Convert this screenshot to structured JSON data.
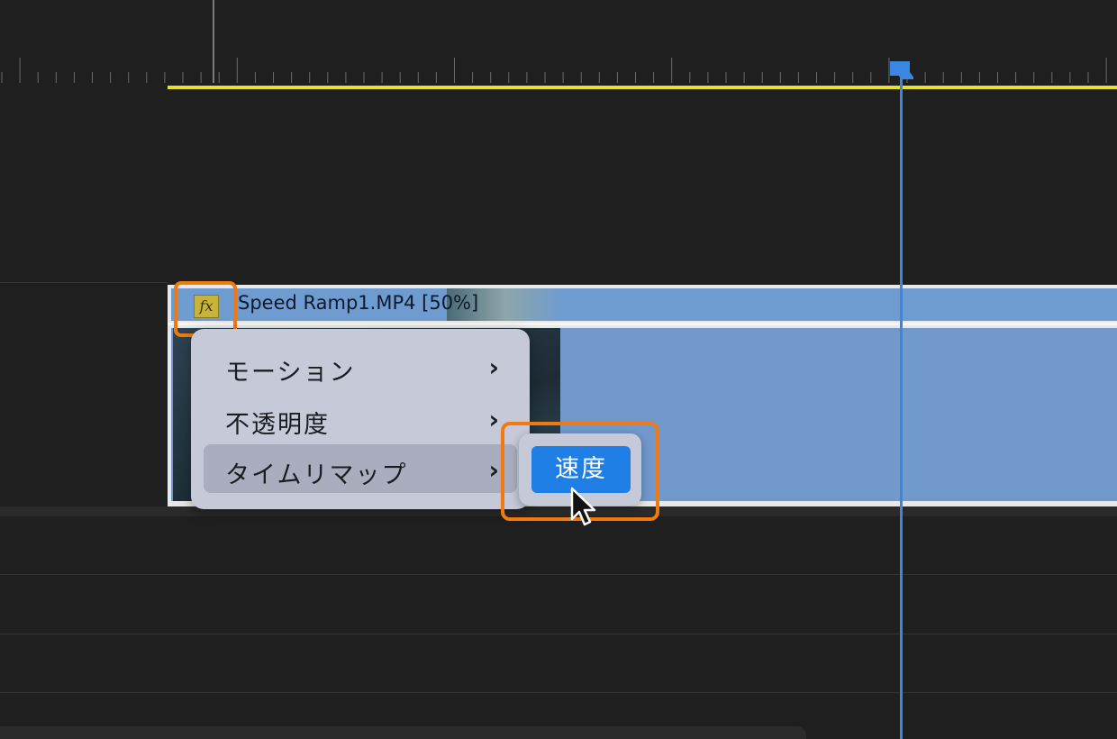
{
  "clip": {
    "title": "Speed Ramp1.MP4 [50%]",
    "fx_label": "fx"
  },
  "context_menu": {
    "items": [
      {
        "label": "モーション",
        "chevron": "›",
        "active": false
      },
      {
        "label": "不透明度",
        "chevron": "›",
        "active": false
      },
      {
        "label": "タイムリマップ",
        "chevron": "›",
        "active": true
      }
    ]
  },
  "submenu": {
    "speed_label": "速度"
  },
  "colors": {
    "highlight": "#f07a10",
    "playhead": "#3a86e0",
    "work_area": "#e6e02a",
    "clip": "#7299cc",
    "accent_button": "#1f7fe6"
  },
  "icons": {
    "fx": "fx-icon",
    "chevron": "chevron-right-icon",
    "cursor": "mouse-pointer-icon"
  }
}
